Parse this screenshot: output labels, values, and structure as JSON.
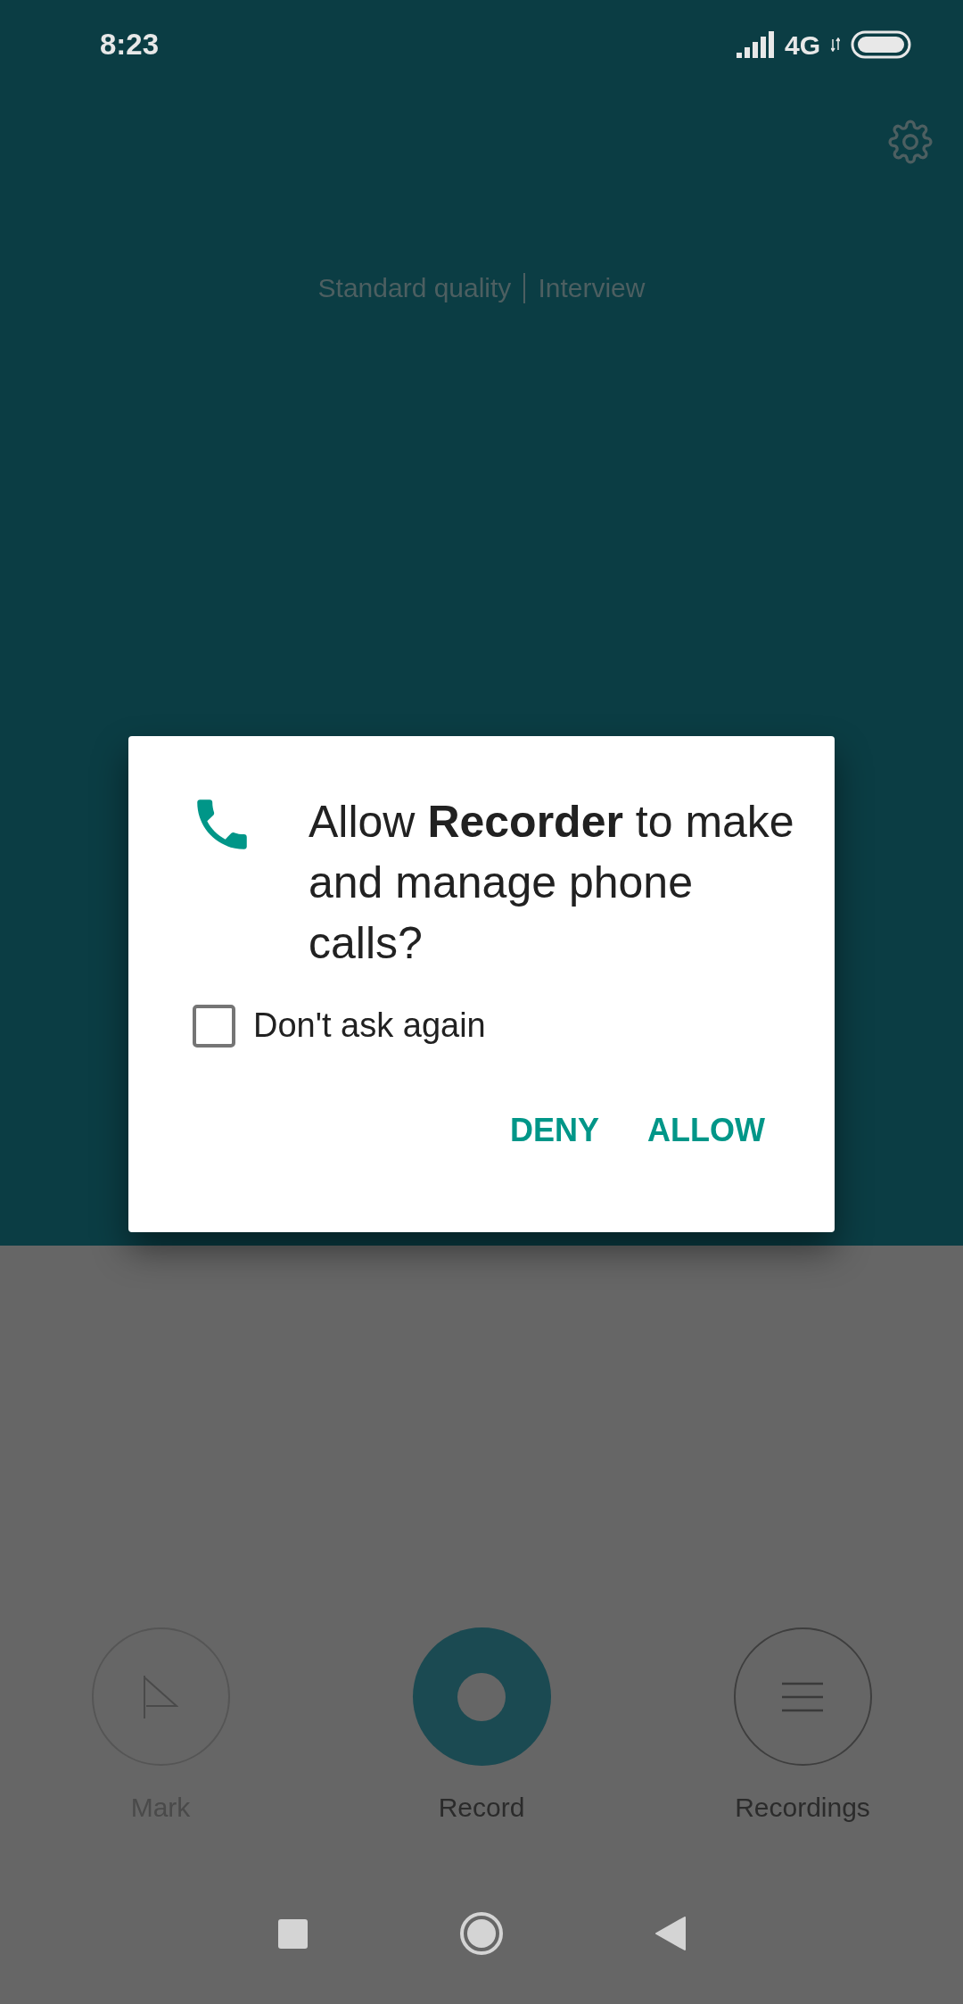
{
  "status_bar": {
    "time": "8:23",
    "network": "4G"
  },
  "recording_mode": [
    "Standard quality",
    "Interview"
  ],
  "dialog": {
    "title": "Allow **Recorder** to make and manage phone calls?",
    "checkbox": {
      "label": "Don't ask again",
      "checked": false
    },
    "buttons": [
      "DENY",
      "ALLOW"
    ]
  },
  "controls": [
    {
      "kind": "mark",
      "label": "Mark",
      "disabled": true
    },
    {
      "kind": "record",
      "label": "Record",
      "disabled": false
    },
    {
      "kind": "list",
      "label": "Recordings",
      "disabled": false
    }
  ]
}
